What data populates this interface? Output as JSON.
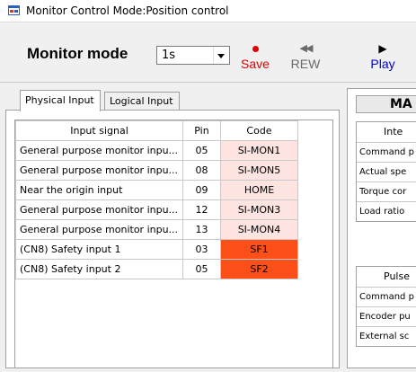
{
  "window": {
    "title": "Monitor  Control Mode:Position control"
  },
  "toolbar": {
    "monitor_mode_label": "Monitor mode",
    "monitor_mode_value": "1s",
    "save_label": "Save",
    "rew_label": "REW",
    "play_label": "Play"
  },
  "tabs": [
    {
      "label": "Physical Input"
    },
    {
      "label": "Logical Input"
    }
  ],
  "input_table": {
    "headers": [
      "Input signal",
      "Pin",
      "Code"
    ],
    "rows": [
      {
        "signal": "General purpose monitor inpu...",
        "pin": "05",
        "code": "SI-MON1"
      },
      {
        "signal": "General purpose monitor inpu...",
        "pin": "08",
        "code": "SI-MON5"
      },
      {
        "signal": "Near the origin input",
        "pin": "09",
        "code": "HOME"
      },
      {
        "signal": "General purpose monitor inpu...",
        "pin": "12",
        "code": "SI-MON3"
      },
      {
        "signal": "General purpose monitor inpu...",
        "pin": "13",
        "code": "SI-MON4"
      },
      {
        "signal": "(CN8) Safety input 1",
        "pin": "03",
        "code": "SF1"
      },
      {
        "signal": "(CN8) Safety input 2",
        "pin": "05",
        "code": "SF2"
      }
    ]
  },
  "right_panel": {
    "heading": "MA",
    "section1": {
      "header": "Inte",
      "rows": [
        "Command p",
        "Actual spe",
        "Torque cor",
        "Load ratio"
      ]
    },
    "section2": {
      "header": "Pulse",
      "rows": [
        "Command p",
        "Encoder pu",
        "External sc"
      ]
    }
  },
  "colors": {
    "code_inactive": "#fde4e0",
    "code_active": "#fd5018",
    "save_red": "#e00000",
    "play_blue": "#0000c8",
    "rew_gray": "#6a6a6a"
  }
}
